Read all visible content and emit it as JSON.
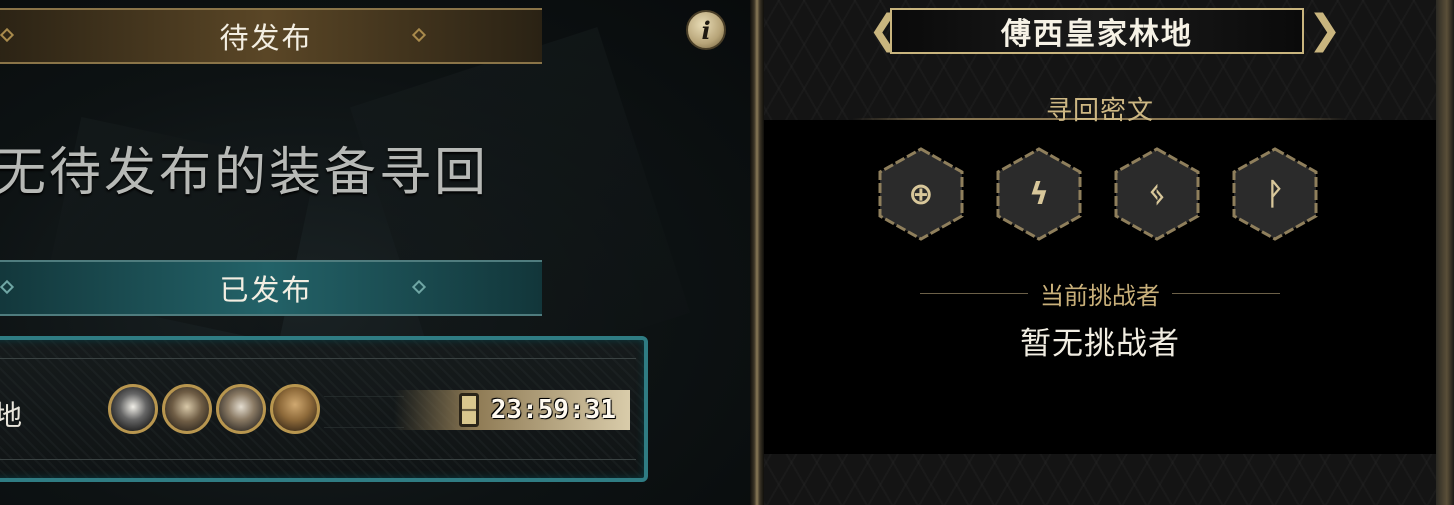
{
  "left_panel": {
    "pending_header": "待发布",
    "pending_empty_message": "无待发布的装备寻回",
    "published_header": "已发布",
    "info_button_glyph": "i",
    "published_item": {
      "name": "地",
      "timer": "23:59:31",
      "avatars": [
        "avatar-1",
        "avatar-2",
        "avatar-3",
        "avatar-4"
      ]
    }
  },
  "right_panel": {
    "location_title": "傅西皇家林地",
    "section_title": "寻回密文",
    "runes": [
      {
        "icon": "rune-1-icon",
        "glyph": "⊕"
      },
      {
        "icon": "rune-2-icon",
        "glyph": "ϟ"
      },
      {
        "icon": "rune-3-icon",
        "glyph": "ᛃ"
      },
      {
        "icon": "rune-4-icon",
        "glyph": "ᚹ"
      }
    ],
    "current_challenger_label": "当前挑战者",
    "current_challenger_value": "暂无挑战者"
  },
  "colors": {
    "gold": "#c9b57e",
    "teal": "#2f7c83",
    "text_light": "#f3eee2"
  }
}
